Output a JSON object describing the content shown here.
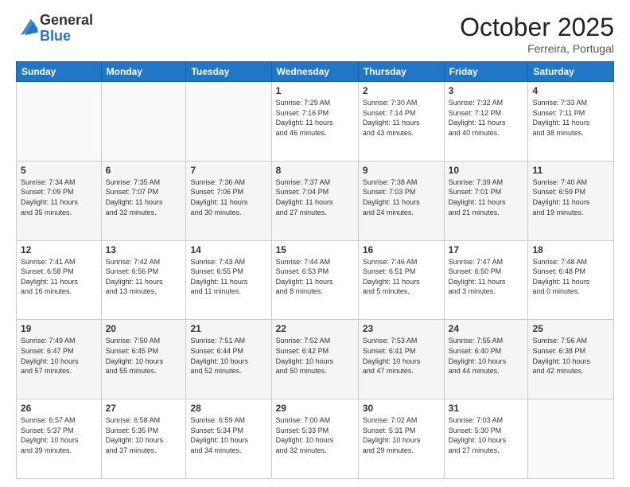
{
  "logo": {
    "general": "General",
    "blue": "Blue"
  },
  "header": {
    "month": "October 2025",
    "location": "Ferreira, Portugal"
  },
  "weekdays": [
    "Sunday",
    "Monday",
    "Tuesday",
    "Wednesday",
    "Thursday",
    "Friday",
    "Saturday"
  ],
  "weeks": [
    [
      {
        "day": "",
        "info": ""
      },
      {
        "day": "",
        "info": ""
      },
      {
        "day": "",
        "info": ""
      },
      {
        "day": "1",
        "info": "Sunrise: 7:29 AM\nSunset: 7:16 PM\nDaylight: 11 hours\nand 46 minutes."
      },
      {
        "day": "2",
        "info": "Sunrise: 7:30 AM\nSunset: 7:14 PM\nDaylight: 11 hours\nand 43 minutes."
      },
      {
        "day": "3",
        "info": "Sunrise: 7:32 AM\nSunset: 7:12 PM\nDaylight: 11 hours\nand 40 minutes."
      },
      {
        "day": "4",
        "info": "Sunrise: 7:33 AM\nSunset: 7:11 PM\nDaylight: 11 hours\nand 38 minutes."
      }
    ],
    [
      {
        "day": "5",
        "info": "Sunrise: 7:34 AM\nSunset: 7:09 PM\nDaylight: 11 hours\nand 35 minutes."
      },
      {
        "day": "6",
        "info": "Sunrise: 7:35 AM\nSunset: 7:07 PM\nDaylight: 11 hours\nand 32 minutes."
      },
      {
        "day": "7",
        "info": "Sunrise: 7:36 AM\nSunset: 7:06 PM\nDaylight: 11 hours\nand 30 minutes."
      },
      {
        "day": "8",
        "info": "Sunrise: 7:37 AM\nSunset: 7:04 PM\nDaylight: 11 hours\nand 27 minutes."
      },
      {
        "day": "9",
        "info": "Sunrise: 7:38 AM\nSunset: 7:03 PM\nDaylight: 11 hours\nand 24 minutes."
      },
      {
        "day": "10",
        "info": "Sunrise: 7:39 AM\nSunset: 7:01 PM\nDaylight: 11 hours\nand 21 minutes."
      },
      {
        "day": "11",
        "info": "Sunrise: 7:40 AM\nSunset: 6:59 PM\nDaylight: 11 hours\nand 19 minutes."
      }
    ],
    [
      {
        "day": "12",
        "info": "Sunrise: 7:41 AM\nSunset: 6:58 PM\nDaylight: 11 hours\nand 16 minutes."
      },
      {
        "day": "13",
        "info": "Sunrise: 7:42 AM\nSunset: 6:56 PM\nDaylight: 11 hours\nand 13 minutes."
      },
      {
        "day": "14",
        "info": "Sunrise: 7:43 AM\nSunset: 6:55 PM\nDaylight: 11 hours\nand 11 minutes."
      },
      {
        "day": "15",
        "info": "Sunrise: 7:44 AM\nSunset: 6:53 PM\nDaylight: 11 hours\nand 8 minutes."
      },
      {
        "day": "16",
        "info": "Sunrise: 7:46 AM\nSunset: 6:51 PM\nDaylight: 11 hours\nand 5 minutes."
      },
      {
        "day": "17",
        "info": "Sunrise: 7:47 AM\nSunset: 6:50 PM\nDaylight: 11 hours\nand 3 minutes."
      },
      {
        "day": "18",
        "info": "Sunrise: 7:48 AM\nSunset: 6:48 PM\nDaylight: 11 hours\nand 0 minutes."
      }
    ],
    [
      {
        "day": "19",
        "info": "Sunrise: 7:49 AM\nSunset: 6:47 PM\nDaylight: 10 hours\nand 57 minutes."
      },
      {
        "day": "20",
        "info": "Sunrise: 7:50 AM\nSunset: 6:45 PM\nDaylight: 10 hours\nand 55 minutes."
      },
      {
        "day": "21",
        "info": "Sunrise: 7:51 AM\nSunset: 6:44 PM\nDaylight: 10 hours\nand 52 minutes."
      },
      {
        "day": "22",
        "info": "Sunrise: 7:52 AM\nSunset: 6:42 PM\nDaylight: 10 hours\nand 50 minutes."
      },
      {
        "day": "23",
        "info": "Sunrise: 7:53 AM\nSunset: 6:41 PM\nDaylight: 10 hours\nand 47 minutes."
      },
      {
        "day": "24",
        "info": "Sunrise: 7:55 AM\nSunset: 6:40 PM\nDaylight: 10 hours\nand 44 minutes."
      },
      {
        "day": "25",
        "info": "Sunrise: 7:56 AM\nSunset: 6:38 PM\nDaylight: 10 hours\nand 42 minutes."
      }
    ],
    [
      {
        "day": "26",
        "info": "Sunrise: 6:57 AM\nSunset: 5:37 PM\nDaylight: 10 hours\nand 39 minutes."
      },
      {
        "day": "27",
        "info": "Sunrise: 6:58 AM\nSunset: 5:35 PM\nDaylight: 10 hours\nand 37 minutes."
      },
      {
        "day": "28",
        "info": "Sunrise: 6:59 AM\nSunset: 5:34 PM\nDaylight: 10 hours\nand 34 minutes."
      },
      {
        "day": "29",
        "info": "Sunrise: 7:00 AM\nSunset: 5:33 PM\nDaylight: 10 hours\nand 32 minutes."
      },
      {
        "day": "30",
        "info": "Sunrise: 7:02 AM\nSunset: 5:31 PM\nDaylight: 10 hours\nand 29 minutes."
      },
      {
        "day": "31",
        "info": "Sunrise: 7:03 AM\nSunset: 5:30 PM\nDaylight: 10 hours\nand 27 minutes."
      },
      {
        "day": "",
        "info": ""
      }
    ]
  ]
}
